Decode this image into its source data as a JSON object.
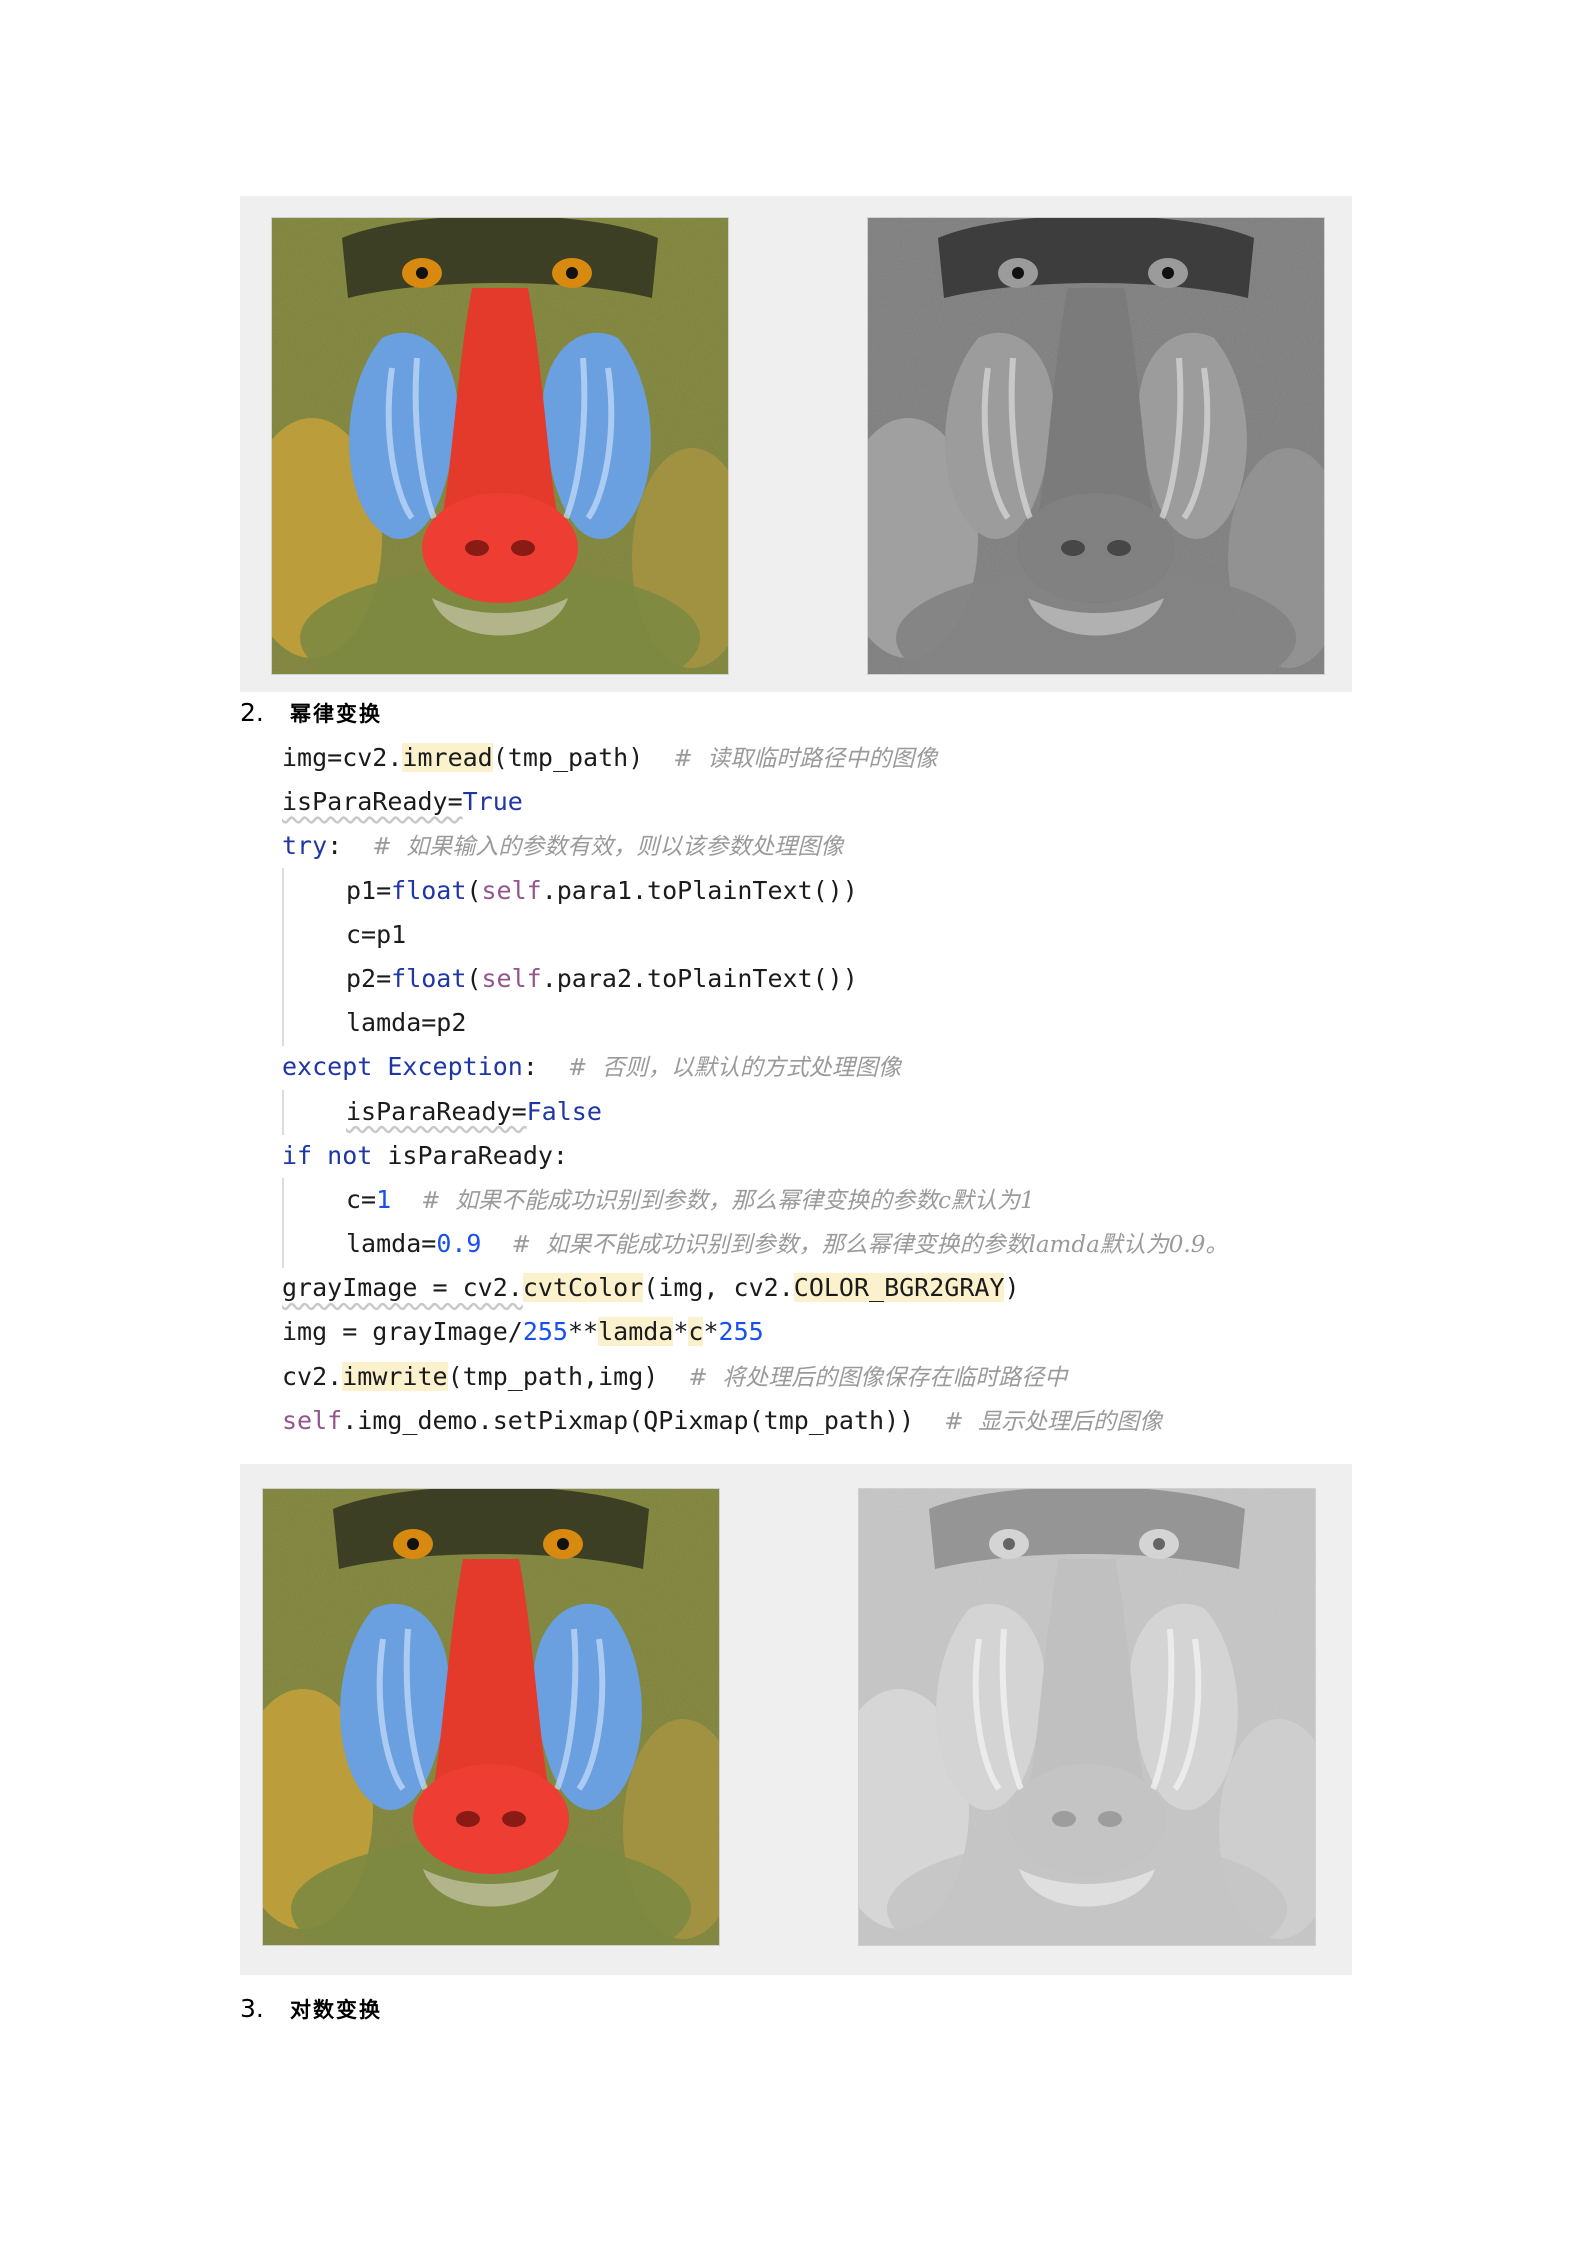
{
  "sections": [
    {
      "number": "2.",
      "title": "幂律变换"
    },
    {
      "number": "3.",
      "title": "对数变换"
    }
  ],
  "figures": [
    {
      "left_image": "mandrill-original-color",
      "right_image": "mandrill-grayscale"
    },
    {
      "left_image": "mandrill-original-color",
      "right_image": "mandrill-power-law-result"
    }
  ],
  "code": {
    "l1": {
      "a": "img=cv2.",
      "fn": "imread",
      "b": "(tmp_path)",
      "c": "#  读取临时路径中的图像"
    },
    "l2": {
      "a": "isParaReady=",
      "kw": "True"
    },
    "l3": {
      "kw": "try",
      "a": ":",
      "c": "#  如果输入的参数有效，则以该参数处理图像"
    },
    "l4": {
      "a": "p1=",
      "fn": "float",
      "b": "(",
      "self": "self",
      "d": ".para1.toPlainText())"
    },
    "l5": {
      "a": "c=p1"
    },
    "l6": {
      "a": "p2=",
      "fn": "float",
      "b": "(",
      "self": "self",
      "d": ".para2.toPlainText())"
    },
    "l7": {
      "a": "lamda=p2"
    },
    "l8": {
      "kw": "except",
      "cls": "Exception",
      "a": ":",
      "c": "#  否则，以默认的方式处理图像"
    },
    "l9": {
      "a": "isParaReady=",
      "kw": "False"
    },
    "l10": {
      "kw": "if not",
      "a": " isParaReady:"
    },
    "l11": {
      "a": "c=",
      "n": "1",
      "c": "#  如果不能成功识别到参数，那么幂律变换的参数c默认为1"
    },
    "l12": {
      "a": "lamda=",
      "n": "0.9",
      "c": "#  如果不能成功识别到参数，那么幂律变换的参数lamda默认为0.9。"
    },
    "l13": {
      "a": "grayImage = cv2.",
      "fn": "cvtColor",
      "b": "(img, cv2.",
      "const": "COLOR_BGR2GRAY",
      "d": ")"
    },
    "l14": {
      "a": "img = grayImage/",
      "n1": "255",
      "b": "**",
      "v1": "lamda",
      "op": "*",
      "v2": "c",
      "op2": "*",
      "n2": "255"
    },
    "l15": {
      "a": "cv2.",
      "fn": "imwrite",
      "b": "(tmp_path,img)",
      "c": "#  将处理后的图像保存在临时路径中"
    },
    "l16": {
      "self": "self",
      "a": ".img_demo.setPixmap(QPixmap(tmp_path))",
      "c": "#  显示处理后的图像"
    }
  },
  "colors": {
    "keyword": "#1f36a6",
    "number": "#1750eb",
    "self": "#94558d",
    "comment": "#9a9a9a",
    "highlight": "#fbf1cc",
    "panel": "#efefef"
  }
}
